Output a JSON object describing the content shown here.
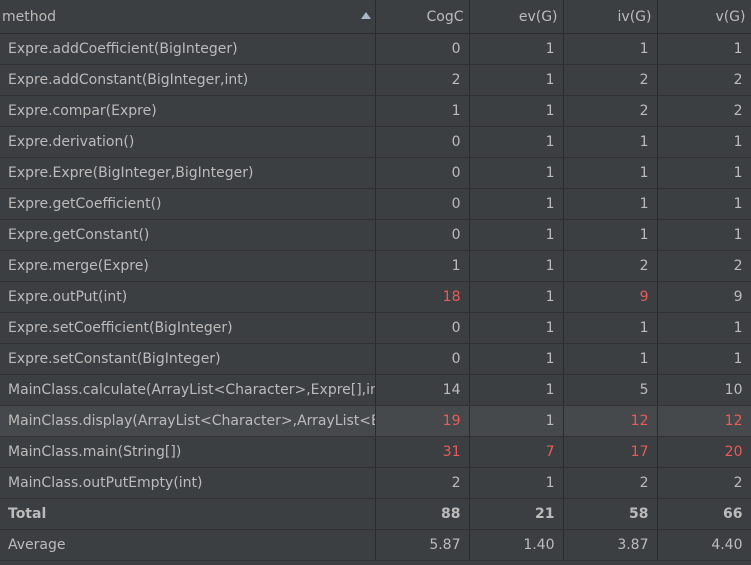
{
  "columns": [
    "method",
    "CogC",
    "ev(G)",
    "iv(G)",
    "v(G)"
  ],
  "rows": [
    {
      "method": "Expre.addCoefficient(BigInteger)",
      "cogc": "0",
      "ev": "1",
      "iv": "1",
      "v": "1"
    },
    {
      "method": "Expre.addConstant(BigInteger,int)",
      "cogc": "2",
      "ev": "1",
      "iv": "2",
      "v": "2"
    },
    {
      "method": "Expre.compar(Expre)",
      "cogc": "1",
      "ev": "1",
      "iv": "2",
      "v": "2"
    },
    {
      "method": "Expre.derivation()",
      "cogc": "0",
      "ev": "1",
      "iv": "1",
      "v": "1"
    },
    {
      "method": "Expre.Expre(BigInteger,BigInteger)",
      "cogc": "0",
      "ev": "1",
      "iv": "1",
      "v": "1"
    },
    {
      "method": "Expre.getCoefficient()",
      "cogc": "0",
      "ev": "1",
      "iv": "1",
      "v": "1"
    },
    {
      "method": "Expre.getConstant()",
      "cogc": "0",
      "ev": "1",
      "iv": "1",
      "v": "1"
    },
    {
      "method": "Expre.merge(Expre)",
      "cogc": "1",
      "ev": "1",
      "iv": "2",
      "v": "2"
    },
    {
      "method": "Expre.outPut(int)",
      "cogc": "18",
      "ev": "1",
      "iv": "9",
      "v": "9"
    },
    {
      "method": "Expre.setCoefficient(BigInteger)",
      "cogc": "0",
      "ev": "1",
      "iv": "1",
      "v": "1"
    },
    {
      "method": "Expre.setConstant(BigInteger)",
      "cogc": "0",
      "ev": "1",
      "iv": "1",
      "v": "1"
    },
    {
      "method": "MainClass.calculate(ArrayList<Character>,Expre[],int)",
      "cogc": "14",
      "ev": "1",
      "iv": "5",
      "v": "10"
    },
    {
      "method": "MainClass.display(ArrayList<Character>,ArrayList<Expre>)",
      "cogc": "19",
      "ev": "1",
      "iv": "12",
      "v": "12"
    },
    {
      "method": "MainClass.main(String[])",
      "cogc": "31",
      "ev": "7",
      "iv": "17",
      "v": "20"
    },
    {
      "method": "MainClass.outPutEmpty(int)",
      "cogc": "2",
      "ev": "1",
      "iv": "2",
      "v": "2"
    }
  ],
  "total": {
    "label": "Total",
    "cogc": "88",
    "ev": "21",
    "iv": "58",
    "v": "66"
  },
  "average": {
    "label": "Average",
    "cogc": "5.87",
    "ev": "1.40",
    "iv": "3.87",
    "v": "4.40"
  },
  "colors": {
    "highlight": "#ec5a5a",
    "background": "#3c3f41",
    "selected_row": "#46494b"
  }
}
